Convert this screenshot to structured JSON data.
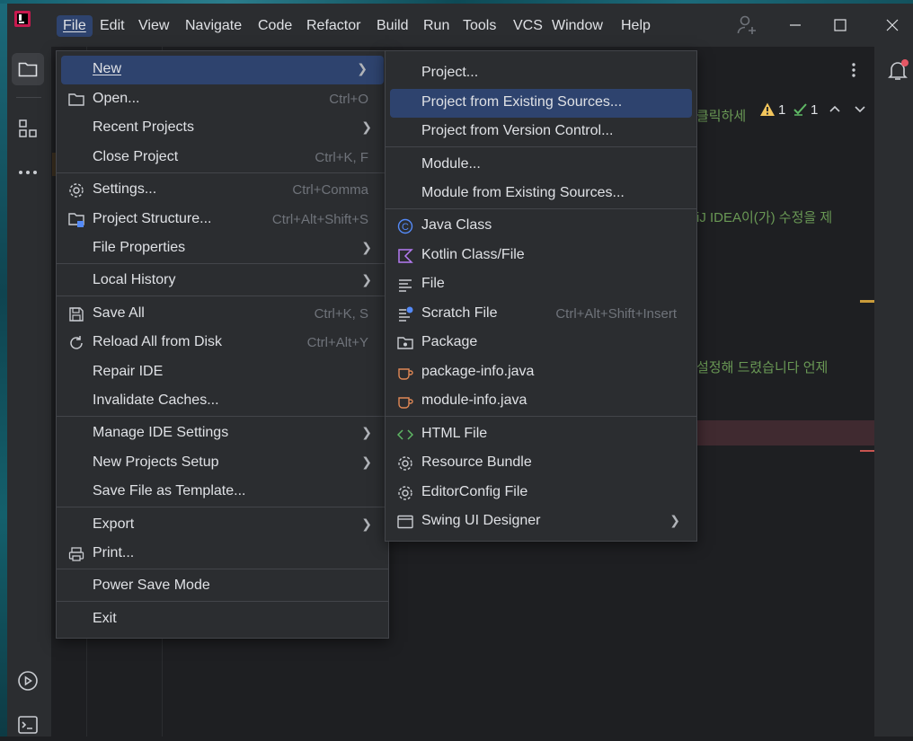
{
  "menubar": {
    "items": [
      "File",
      "Edit",
      "View",
      "Navigate",
      "Code",
      "Refactor",
      "Build",
      "Run",
      "Tools",
      "VCS",
      "Window",
      "Help"
    ]
  },
  "editor": {
    "line1": "클릭하세",
    "line2": "iJ IDEA이(가) 수정을 제",
    "line3": "설정해 드렸습니다 언제",
    "warnings": "1",
    "checks": "1"
  },
  "file_menu": {
    "items": [
      {
        "label": "New",
        "shortcut": "",
        "submenu": true
      },
      {
        "label": "Open...",
        "shortcut": "Ctrl+O",
        "submenu": false
      },
      {
        "label": "Recent Projects",
        "shortcut": "",
        "submenu": true
      },
      {
        "label": "Close Project",
        "shortcut": "Ctrl+K, F",
        "submenu": false
      },
      {
        "label": "Settings...",
        "shortcut": "Ctrl+Comma",
        "submenu": false
      },
      {
        "label": "Project Structure...",
        "shortcut": "Ctrl+Alt+Shift+S",
        "submenu": false
      },
      {
        "label": "File Properties",
        "shortcut": "",
        "submenu": true
      },
      {
        "label": "Local History",
        "shortcut": "",
        "submenu": true
      },
      {
        "label": "Save All",
        "shortcut": "Ctrl+K, S",
        "submenu": false
      },
      {
        "label": "Reload All from Disk",
        "shortcut": "Ctrl+Alt+Y",
        "submenu": false
      },
      {
        "label": "Repair IDE",
        "shortcut": "",
        "submenu": false
      },
      {
        "label": "Invalidate Caches...",
        "shortcut": "",
        "submenu": false
      },
      {
        "label": "Manage IDE Settings",
        "shortcut": "",
        "submenu": true
      },
      {
        "label": "New Projects Setup",
        "shortcut": "",
        "submenu": true
      },
      {
        "label": "Save File as Template...",
        "shortcut": "",
        "submenu": false
      },
      {
        "label": "Export",
        "shortcut": "",
        "submenu": true
      },
      {
        "label": "Print...",
        "shortcut": "",
        "submenu": false
      },
      {
        "label": "Power Save Mode",
        "shortcut": "",
        "submenu": false
      },
      {
        "label": "Exit",
        "shortcut": "",
        "submenu": false
      }
    ]
  },
  "new_submenu": {
    "items": [
      {
        "label": "Project...",
        "shortcut": ""
      },
      {
        "label": "Project from Existing Sources...",
        "shortcut": ""
      },
      {
        "label": "Project from Version Control...",
        "shortcut": ""
      },
      {
        "label": "Module...",
        "shortcut": ""
      },
      {
        "label": "Module from Existing Sources...",
        "shortcut": ""
      },
      {
        "label": "Java Class",
        "shortcut": ""
      },
      {
        "label": "Kotlin Class/File",
        "shortcut": ""
      },
      {
        "label": "File",
        "shortcut": ""
      },
      {
        "label": "Scratch File",
        "shortcut": "Ctrl+Alt+Shift+Insert"
      },
      {
        "label": "Package",
        "shortcut": ""
      },
      {
        "label": "package-info.java",
        "shortcut": ""
      },
      {
        "label": "module-info.java",
        "shortcut": ""
      },
      {
        "label": "HTML File",
        "shortcut": ""
      },
      {
        "label": "Resource Bundle",
        "shortcut": ""
      },
      {
        "label": "EditorConfig File",
        "shortcut": ""
      },
      {
        "label": "Swing UI Designer",
        "shortcut": ""
      }
    ]
  },
  "colors": {
    "selection": "#2e436e",
    "popup_bg": "#2b2d30",
    "accent_java": "#548af7",
    "accent_kotlin": "#b57bf2",
    "accent_orange": "#e08855"
  }
}
